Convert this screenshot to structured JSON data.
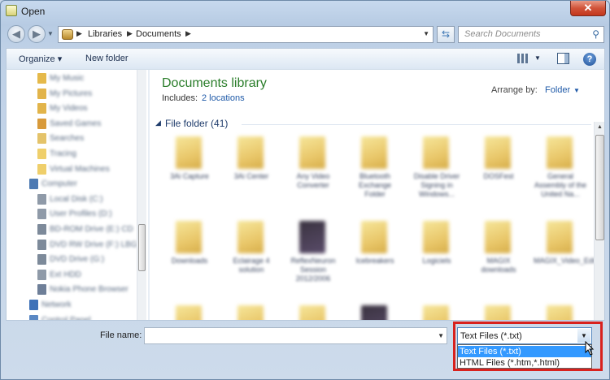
{
  "window": {
    "title": "Open",
    "close_glyph": "✕"
  },
  "address_bar": {
    "crumbs": [
      "Libraries",
      "Documents"
    ],
    "search_placeholder": "Search Documents"
  },
  "toolbar": {
    "organize_label": "Organize ▾",
    "new_folder_label": "New folder"
  },
  "nav_pane": {
    "items": [
      {
        "label": "My Music",
        "icon": "music-library-icon"
      },
      {
        "label": "My Pictures",
        "icon": "pictures-library-icon"
      },
      {
        "label": "My Videos",
        "icon": "videos-library-icon"
      },
      {
        "label": "Saved Games",
        "icon": "saved-games-icon"
      },
      {
        "label": "Searches",
        "icon": "searches-icon"
      },
      {
        "label": "Tracing",
        "icon": "folder-icon"
      },
      {
        "label": "Virtual Machines",
        "icon": "folder-icon"
      },
      {
        "label": "Computer",
        "icon": "computer-icon"
      },
      {
        "label": "Local Disk (C:)",
        "icon": "disk-icon"
      },
      {
        "label": "User Profiles (D:)",
        "icon": "disk-icon"
      },
      {
        "label": "BD-ROM Drive (E:) CD",
        "icon": "optical-drive-icon"
      },
      {
        "label": "DVD RW Drive (F:) LBG",
        "icon": "optical-drive-icon"
      },
      {
        "label": "DVD Drive (G:)",
        "icon": "optical-drive-icon"
      },
      {
        "label": "Ext HDD",
        "icon": "disk-icon"
      },
      {
        "label": "Nokia Phone Browser",
        "icon": "phone-icon"
      },
      {
        "label": "Network",
        "icon": "network-icon"
      },
      {
        "label": "Control Panel",
        "icon": "control-panel-icon"
      }
    ]
  },
  "library": {
    "title": "Documents library",
    "includes_label": "Includes:",
    "locations_link": "2 locations",
    "arrange_label": "Arrange by:",
    "arrange_value": "Folder",
    "group_label": "File folder (41)"
  },
  "folders": [
    {
      "name": "3Ai Capture"
    },
    {
      "name": "3Ai Center"
    },
    {
      "name": "Any Video Converter"
    },
    {
      "name": "Bluetooth Exchange Folder"
    },
    {
      "name": "Disable Driver Signing in Windows..."
    },
    {
      "name": "DOSFest"
    },
    {
      "name": "General Assembly of the United Na..."
    },
    {
      "name": "Downloads"
    },
    {
      "name": "Eclairage 4 solution"
    },
    {
      "name": "ReflexNeuron Session 2012/2006"
    },
    {
      "name": "Icebreakers"
    },
    {
      "name": "Logiciels"
    },
    {
      "name": "MAGIX downloads"
    },
    {
      "name": "MAGIX_Video_Edit_Pro_2_shot"
    },
    {
      "name": ""
    },
    {
      "name": ""
    },
    {
      "name": ""
    },
    {
      "name": ""
    },
    {
      "name": ""
    },
    {
      "name": ""
    },
    {
      "name": ""
    }
  ],
  "footer": {
    "file_name_label": "File name:",
    "file_name_value": "",
    "filetype_selected": "Text Files (*.txt)",
    "filetype_options": [
      "Text Files (*.txt)",
      "HTML Files (*.htm,*.html)"
    ]
  },
  "colors": {
    "highlight_box": "#d8211d",
    "selection": "#3399ff",
    "library_title": "#2a7d2a"
  }
}
